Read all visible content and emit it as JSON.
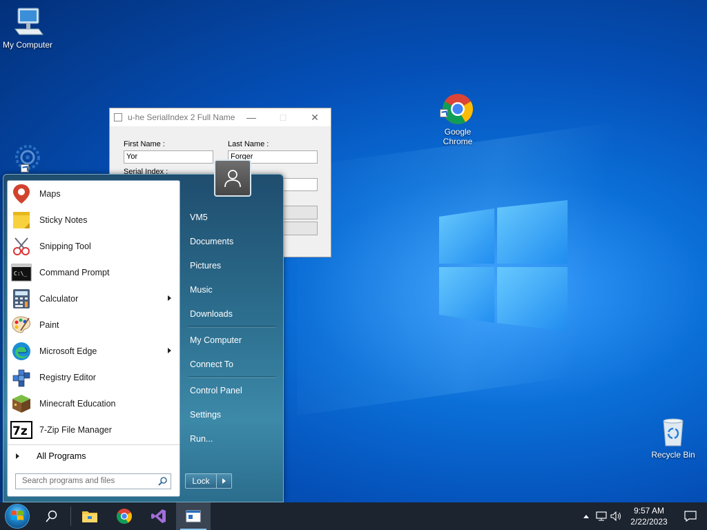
{
  "desktop": {
    "icons": [
      {
        "label": "My Computer"
      },
      {
        "label": "Google\nChrome"
      },
      {
        "label": "Recycle Bin"
      }
    ]
  },
  "dialog": {
    "title": "u-he SerialIndex 2 Full Name",
    "first_name_label": "First Name :",
    "first_name_value": "Yor",
    "last_name_label": "Last Name :",
    "last_name_value": "Forger",
    "serial_label": "Serial Index :"
  },
  "start_menu": {
    "programs": [
      {
        "label": "Maps",
        "icon": "maps-icon",
        "submenu": false
      },
      {
        "label": "Sticky Notes",
        "icon": "sticky-notes-icon",
        "submenu": false
      },
      {
        "label": "Snipping Tool",
        "icon": "snipping-tool-icon",
        "submenu": false
      },
      {
        "label": "Command Prompt",
        "icon": "command-prompt-icon",
        "submenu": false
      },
      {
        "label": "Calculator",
        "icon": "calculator-icon",
        "submenu": true
      },
      {
        "label": "Paint",
        "icon": "paint-icon",
        "submenu": false
      },
      {
        "label": "Microsoft Edge",
        "icon": "edge-icon",
        "submenu": true
      },
      {
        "label": "Registry Editor",
        "icon": "registry-editor-icon",
        "submenu": false
      },
      {
        "label": "Minecraft Education",
        "icon": "minecraft-icon",
        "submenu": false
      },
      {
        "label": "7-Zip File Manager",
        "icon": "7zip-icon",
        "submenu": false
      }
    ],
    "all_programs": "All Programs",
    "search_placeholder": "Search programs and files",
    "right_links": {
      "user": "VM5",
      "documents": "Documents",
      "pictures": "Pictures",
      "music": "Music",
      "downloads": "Downloads",
      "my_computer": "My Computer",
      "connect_to": "Connect To",
      "control_panel": "Control Panel",
      "settings": "Settings",
      "run": "Run..."
    },
    "lock_label": "Lock"
  },
  "taskbar": {
    "time": "9:57 AM",
    "date": "2/22/2023"
  }
}
